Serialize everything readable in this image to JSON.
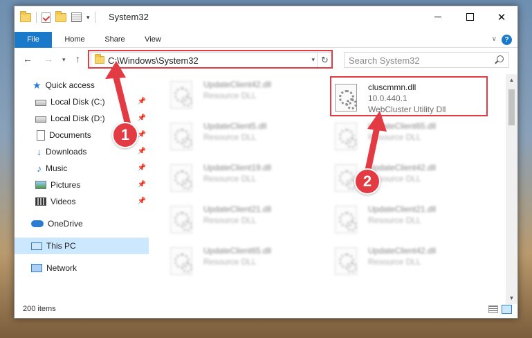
{
  "window": {
    "title": "System32"
  },
  "ribbon": {
    "tabs": [
      "File",
      "Home",
      "Share",
      "View"
    ],
    "help_label": "?"
  },
  "nav": {
    "address": "C:\\Windows\\System32",
    "search_placeholder": "Search System32"
  },
  "sidebar": {
    "items": [
      {
        "label": "Quick access"
      },
      {
        "label": "Local Disk (C:)"
      },
      {
        "label": "Local Disk (D:)"
      },
      {
        "label": "Documents"
      },
      {
        "label": "Downloads"
      },
      {
        "label": "Music"
      },
      {
        "label": "Pictures"
      },
      {
        "label": "Videos"
      },
      {
        "label": "OneDrive"
      },
      {
        "label": "This PC"
      },
      {
        "label": "Network"
      }
    ]
  },
  "files": {
    "highlighted": {
      "name": "cluscmmn.dll",
      "version": "10.0.440.1",
      "description": "WebCluster Utility Dll"
    },
    "left_column": [
      {
        "name": "UpdateClient42.dll",
        "type": "Resource DLL"
      },
      {
        "name": "UpdateClient5.dll",
        "type": "Resource DLL"
      },
      {
        "name": "UpdateClient19.dll",
        "type": "Resource DLL"
      },
      {
        "name": "UpdateClient21.dll",
        "type": "Resource DLL"
      },
      {
        "name": "UpdateClient65.dll",
        "type": "Resource DLL"
      }
    ],
    "right_column": [
      {
        "name": "UpdateClient65.dll",
        "type": "Resource DLL"
      },
      {
        "name": "UpdateClient42.dll",
        "type": "Resource DLL"
      },
      {
        "name": "UpdateClient21.dll",
        "type": "Resource DLL"
      },
      {
        "name": "UpdateClient42.dll",
        "type": "Resource DLL"
      }
    ]
  },
  "status": {
    "item_count": "200 items"
  },
  "annotations": {
    "callout_1": "1",
    "callout_2": "2",
    "accent_color": "#e23b44"
  }
}
